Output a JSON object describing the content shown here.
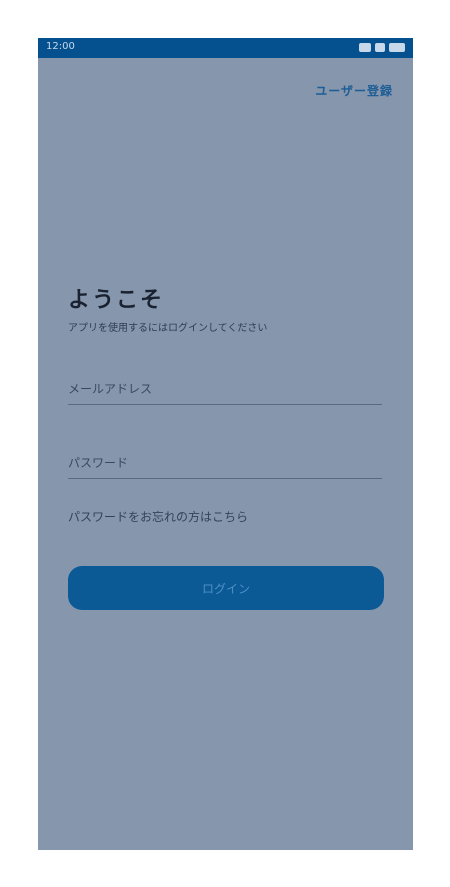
{
  "status_bar": {
    "time": "12:00"
  },
  "header": {
    "register_label": "ユーザー登録"
  },
  "welcome": {
    "title": "ようこそ",
    "subtitle": "アプリを使用するにはログインしてください"
  },
  "form": {
    "email_placeholder": "メールアドレス",
    "email_value": "",
    "password_placeholder": "パスワード",
    "password_value": "",
    "forgot_password_label": "パスワードをお忘れの方はこちら",
    "login_label": "ログイン"
  },
  "colors": {
    "status_bar": "#05518f",
    "screen_background": "#8596ad",
    "primary_button": "#0b5a96",
    "link": "#1e5d95"
  },
  "icons": [
    "signal-icon",
    "wifi-icon",
    "battery-icon"
  ]
}
